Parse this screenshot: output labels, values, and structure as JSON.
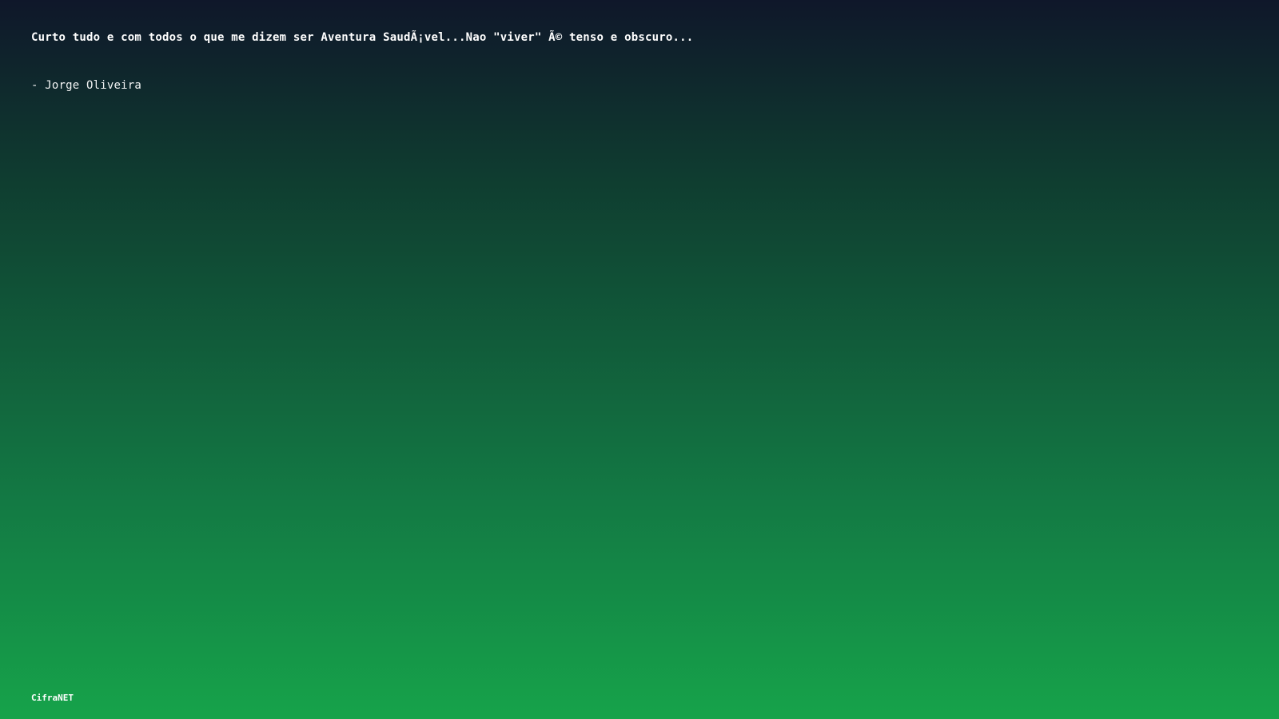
{
  "quote": {
    "text": "Curto tudo e com todos o que me dizem ser Aventura SaudÃ¡vel...Nao \"viver\" Ã© tenso e obscuro...",
    "author": "- Jorge Oliveira"
  },
  "footer": {
    "brand": "CifraNET"
  },
  "colors": {
    "gradient_top": "#0f172a",
    "gradient_bottom": "#16a34a",
    "text": "#ffffff"
  }
}
